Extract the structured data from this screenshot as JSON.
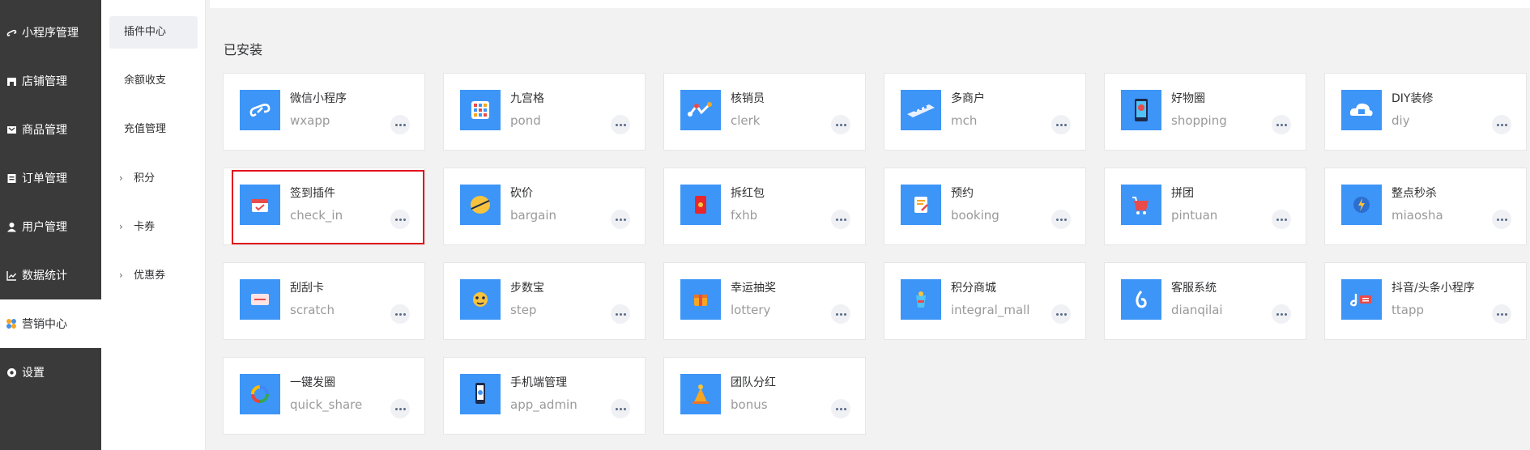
{
  "sidebar": {
    "items": [
      {
        "label": "小程序管理",
        "icon": "miniprogram-icon"
      },
      {
        "label": "店铺管理",
        "icon": "store-icon"
      },
      {
        "label": "商品管理",
        "icon": "goods-icon"
      },
      {
        "label": "订单管理",
        "icon": "order-icon"
      },
      {
        "label": "用户管理",
        "icon": "user-icon"
      },
      {
        "label": "数据统计",
        "icon": "stats-icon"
      },
      {
        "label": "营销中心",
        "icon": "marketing-icon",
        "active": true
      },
      {
        "label": "设置",
        "icon": "settings-icon"
      }
    ]
  },
  "submenu": {
    "items": [
      {
        "label": "插件中心",
        "active": true
      },
      {
        "label": "余额收支"
      },
      {
        "label": "充值管理"
      },
      {
        "label": "积分",
        "expandable": true
      },
      {
        "label": "卡券",
        "expandable": true
      },
      {
        "label": "优惠券",
        "expandable": true
      }
    ]
  },
  "main": {
    "section_title": "已安装",
    "accent_color": "#3d95f7",
    "highlight_color": "#e0121b",
    "plugins": [
      {
        "name": "微信小程序",
        "code": "wxapp",
        "icon": "wechat-miniprogram-icon"
      },
      {
        "name": "九宫格",
        "code": "pond",
        "icon": "grid-icon"
      },
      {
        "name": "核销员",
        "code": "clerk",
        "icon": "clerk-icon"
      },
      {
        "name": "多商户",
        "code": "mch",
        "icon": "merchants-icon"
      },
      {
        "name": "好物圈",
        "code": "shopping",
        "icon": "shopping-circle-icon"
      },
      {
        "name": "DIY装修",
        "code": "diy",
        "icon": "diy-icon"
      },
      {
        "name": "签到插件",
        "code": "check_in",
        "icon": "checkin-icon"
      },
      {
        "name": "砍价",
        "code": "bargain",
        "icon": "bargain-icon"
      },
      {
        "name": "拆红包",
        "code": "fxhb",
        "icon": "red-packet-icon"
      },
      {
        "name": "预约",
        "code": "booking",
        "icon": "booking-icon"
      },
      {
        "name": "拼团",
        "code": "pintuan",
        "icon": "pintuan-icon"
      },
      {
        "name": "整点秒杀",
        "code": "miaosha",
        "icon": "flash-sale-icon"
      },
      {
        "name": "刮刮卡",
        "code": "scratch",
        "icon": "scratch-card-icon"
      },
      {
        "name": "步数宝",
        "code": "step",
        "icon": "step-icon"
      },
      {
        "name": "幸运抽奖",
        "code": "lottery",
        "icon": "lottery-icon"
      },
      {
        "name": "积分商城",
        "code": "integral_mall",
        "icon": "integral-mall-icon"
      },
      {
        "name": "客服系统",
        "code": "dianqilai",
        "icon": "customer-service-icon"
      },
      {
        "name": "抖音/头条小程序",
        "code": "ttapp",
        "icon": "douyin-icon"
      },
      {
        "name": "一键发圈",
        "code": "quick_share",
        "icon": "quick-share-icon"
      },
      {
        "name": "手机端管理",
        "code": "app_admin",
        "icon": "mobile-admin-icon"
      },
      {
        "name": "团队分红",
        "code": "bonus",
        "icon": "bonus-icon"
      }
    ]
  }
}
